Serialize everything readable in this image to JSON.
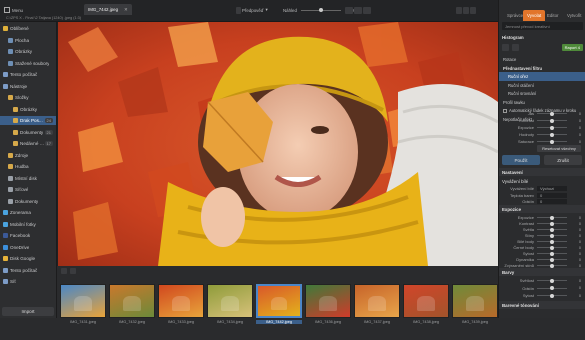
{
  "window": {
    "title": "IMG_7442.jpeg",
    "left_menu": "Menu",
    "path_label": "C:\\ZPS X - Final \\2 Tatjana (1240) .jpeg (1:3)"
  },
  "toolbar": {
    "mode": "Předpověď",
    "zoom_label": "Náhled",
    "zoom_value": "40 %"
  },
  "top_tabs": [
    {
      "label": "Správce",
      "active": false
    },
    {
      "label": "Vyvolat",
      "active": true
    },
    {
      "label": "Editor",
      "active": false
    },
    {
      "label": "Vytvořit",
      "active": false
    }
  ],
  "right_header": {
    "search_placeholder": "Jemnost převod kreativní",
    "histogram": "Histogram",
    "preset_label": "Raport 4"
  },
  "sidebar": {
    "items": [
      {
        "label": "Oblíbené",
        "level": 0,
        "color": "#e0b13a"
      },
      {
        "label": "Plocha",
        "level": 1,
        "color": "#6e8fb5"
      },
      {
        "label": "Obrázky",
        "level": 1,
        "color": "#6e8fb5"
      },
      {
        "label": "Stažené soubory",
        "level": 1,
        "color": "#6e8fb5"
      },
      {
        "label": "Tento počítač",
        "level": 0,
        "color": "#7d9cc7"
      },
      {
        "label": "Nástroje",
        "level": 0,
        "color": "#7d9cc7"
      },
      {
        "label": "Složky",
        "level": 1,
        "color": "#d6a94a"
      },
      {
        "label": "Obrázky",
        "level": 2,
        "color": "#d6a94a"
      },
      {
        "label": "Drak Pos...",
        "level": 2,
        "color": "#d6a94a",
        "selected": true,
        "badge": "24"
      },
      {
        "label": "Dokumenty",
        "level": 2,
        "color": "#d6a94a",
        "badge": "21"
      },
      {
        "label": "Nedávné soubory",
        "level": 2,
        "color": "#d6a94a",
        "badge": "17"
      },
      {
        "label": "Zdroje",
        "level": 1,
        "color": "#d6a94a"
      },
      {
        "label": "Hudba",
        "level": 1,
        "color": "#d6a94a"
      },
      {
        "label": "Místní disk",
        "level": 1,
        "color": "#9aa0a8"
      },
      {
        "label": "Síťové",
        "level": 1,
        "color": "#9aa0a8"
      },
      {
        "label": "Dokumenty",
        "level": 1,
        "color": "#9aa0a8"
      },
      {
        "label": "Zonerama",
        "level": 0,
        "color": "#4aa3df"
      },
      {
        "label": "Mobilní fotky",
        "level": 0,
        "color": "#4aa3df"
      },
      {
        "label": "Facebook",
        "level": 0,
        "color": "#3b5998"
      },
      {
        "label": "OneDrive",
        "level": 0,
        "color": "#3c8fdc"
      },
      {
        "label": "Disk Google",
        "level": 0,
        "color": "#e7b33a"
      },
      {
        "label": "Tento počítač",
        "level": 0,
        "color": "#7d9cc7"
      },
      {
        "label": "Síť",
        "level": 0,
        "color": "#7d9cc7"
      }
    ],
    "import_button": "Import"
  },
  "panel": {
    "rows": [
      {
        "label": "Rotace",
        "kind": "icon"
      },
      {
        "label": "Přednastavení filtru",
        "kind": "header"
      },
      {
        "label": "Ruční ořez",
        "kind": "item",
        "selected": true
      },
      {
        "label": "Ruční otáčení",
        "kind": "item"
      },
      {
        "label": "Ruční srovnání",
        "kind": "item"
      },
      {
        "label": "Profil rawku",
        "kind": "sub"
      },
      {
        "label": "Automatický řádek záznamu v kroku",
        "kind": "check"
      },
      {
        "label": "Nepotlačit efekt",
        "kind": "sub"
      }
    ],
    "adjust_sliders": [
      {
        "label": "Jas",
        "value": "0"
      },
      {
        "label": "Kontrast",
        "value": "0"
      },
      {
        "label": "Expozice",
        "value": "0"
      },
      {
        "label": "Hodnoty",
        "value": "0"
      },
      {
        "label": "Saturace",
        "value": "0"
      }
    ],
    "reset_button": "Resetovat všechny",
    "apply_button": "Použít",
    "cancel_button": "Zrušit",
    "section_basic": "Nastavení",
    "white_balance": "Vyvážení bílé",
    "wb_fields": [
      {
        "label": "Vyvážení bílé",
        "value": "Výchozí"
      },
      {
        "label": "Teplota barev",
        "value": "0"
      },
      {
        "label": "Odstín",
        "value": "0"
      }
    ],
    "exposure_section": "Expozice",
    "exposure_sliders": [
      {
        "label": "Expozice",
        "value": "0"
      },
      {
        "label": "Kontrast",
        "value": "0"
      },
      {
        "label": "Světla",
        "value": "0"
      },
      {
        "label": "Stíny",
        "value": "0"
      },
      {
        "label": "Bílé body",
        "value": "0"
      },
      {
        "label": "Černé body",
        "value": "0"
      },
      {
        "label": "Sytost",
        "value": "0"
      },
      {
        "label": "Dynamika",
        "value": "0"
      },
      {
        "label": "Zvýraznění stínů",
        "value": "0"
      }
    ],
    "color_section": "Barvy",
    "color_sliders": [
      {
        "label": "Světlost",
        "value": "0"
      },
      {
        "label": "Odstín",
        "value": "0"
      },
      {
        "label": "Sytost",
        "value": "0"
      }
    ],
    "footer_section": "Barevné tónování"
  },
  "filmstrip": {
    "thumbs": [
      {
        "label": "IMG_7431.jpeg"
      },
      {
        "label": "IMG_7432.jpeg"
      },
      {
        "label": "IMG_7433.jpeg"
      },
      {
        "label": "IMG_7434.jpeg"
      },
      {
        "label": "IMG_7442.jpeg",
        "selected": true
      },
      {
        "label": "IMG_7436.jpeg"
      },
      {
        "label": "IMG_7437.jpeg"
      },
      {
        "label": "IMG_7438.jpeg"
      },
      {
        "label": "IMG_7439.jpeg"
      }
    ]
  },
  "colors": {
    "accent": "#4f8a3a",
    "selection": "#3b5f8a",
    "orange": "#e2752b"
  }
}
